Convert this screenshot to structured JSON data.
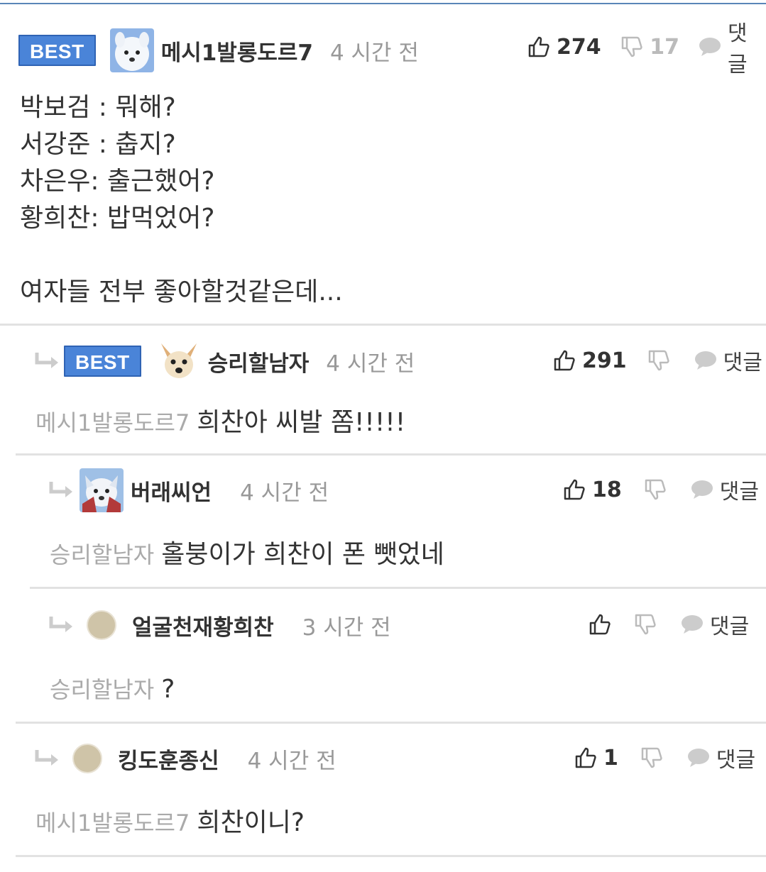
{
  "comments": [
    {
      "best_label": "BEST",
      "nickname": "메시1발롱도르7",
      "time": "4 시간 전",
      "likes": "274",
      "dislikes": "17",
      "reply_label": "댓글",
      "body": [
        "박보검 : 뭐해?",
        "서강준 : 춥지?",
        "차은우: 출근했어?",
        "황희찬: 밥먹었어?",
        "",
        "여자들 전부 좋아할것같은데..."
      ]
    },
    {
      "best_label": "BEST",
      "nickname": "승리할남자",
      "time": "4 시간 전",
      "likes": "291",
      "dislikes": "",
      "reply_label": "댓글",
      "mention": "메시1발롱도르7",
      "body": "희찬아 씨발 쫌!!!!!"
    },
    {
      "nickname": "버래씨언",
      "time": "4 시간 전",
      "likes": "18",
      "dislikes": "",
      "reply_label": "댓글",
      "mention": "승리할남자",
      "body": "홀붕이가 희찬이 폰 뺏었네"
    },
    {
      "nickname": "얼굴천재황희찬",
      "time": "3 시간 전",
      "likes": "",
      "dislikes": "",
      "reply_label": "댓글",
      "mention": "승리할남자",
      "body": "?"
    },
    {
      "nickname": "킹도훈종신",
      "time": "4 시간 전",
      "likes": "1",
      "dislikes": "",
      "reply_label": "댓글",
      "mention": "메시1발롱도르7",
      "body": "희찬이니?"
    }
  ],
  "colors": {
    "best_badge": "#4a84d8",
    "nickname": "#333333",
    "time": "#999999",
    "mention": "#aaaaaa",
    "separator": "#e2e2e2"
  },
  "icons": {
    "like": "thumbs-up-icon",
    "dislike": "thumbs-down-icon",
    "reply": "speech-bubble-icon",
    "reply_indicator": "reply-arrow-icon"
  }
}
